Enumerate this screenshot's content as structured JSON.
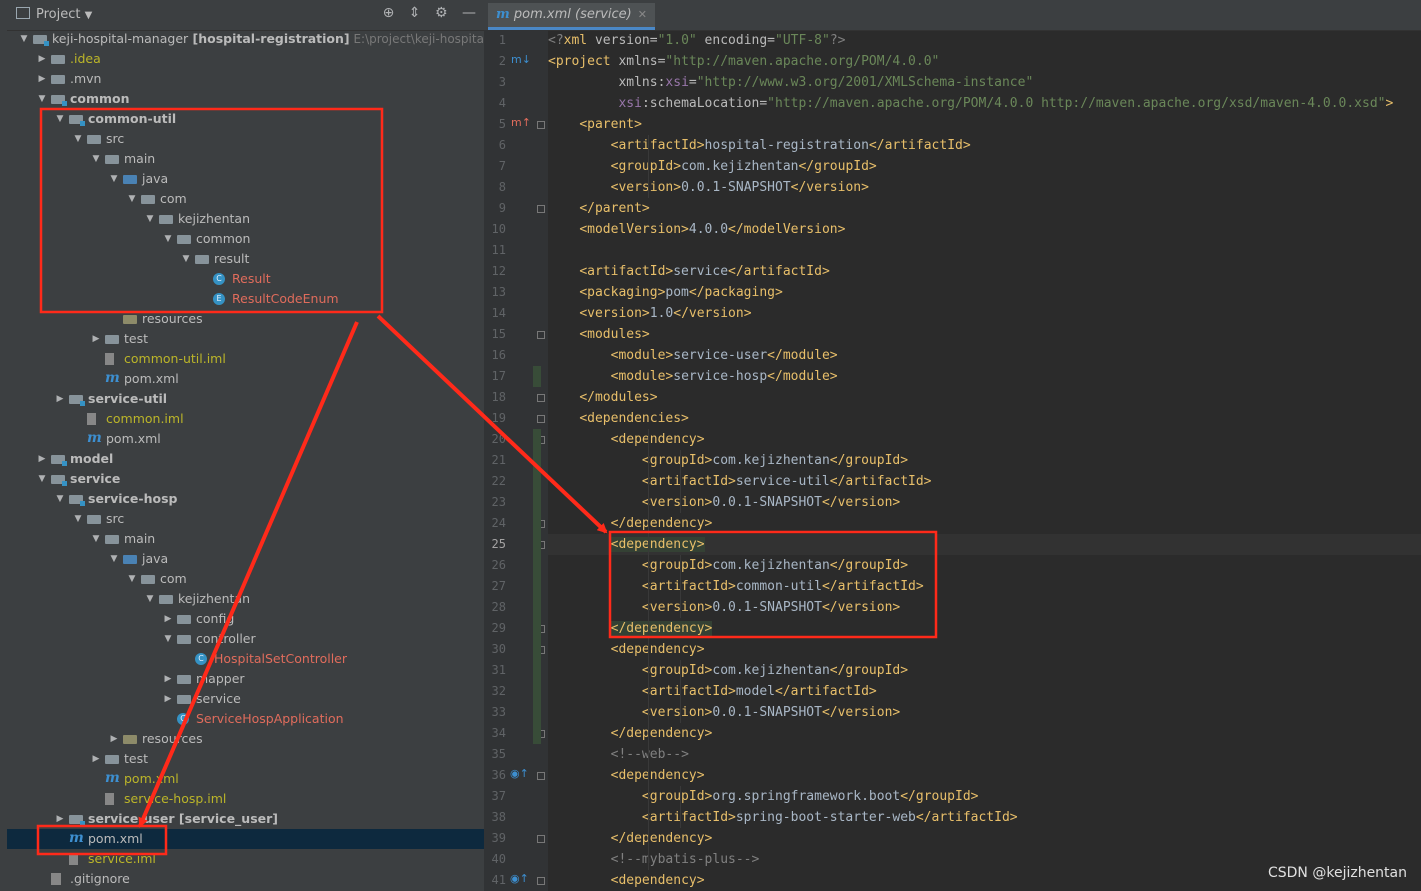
{
  "project_panel": {
    "title": "Project",
    "tree": [
      {
        "depth": 0,
        "arrow": "down",
        "icon": "folder-module",
        "name": "keji-hospital-manager",
        "extra": "[hospital-registration]",
        "path": "E:\\project\\keji-hospital-manager",
        "style": "root"
      },
      {
        "depth": 1,
        "arrow": "right",
        "icon": "folder",
        "name": ".idea",
        "style": "yellow"
      },
      {
        "depth": 1,
        "arrow": "right",
        "icon": "folder",
        "name": ".mvn",
        "style": "normal"
      },
      {
        "depth": 1,
        "arrow": "down",
        "icon": "folder-module",
        "name": "common",
        "style": "bold"
      },
      {
        "depth": 2,
        "arrow": "down",
        "icon": "folder-module",
        "name": "common-util",
        "style": "bold"
      },
      {
        "depth": 3,
        "arrow": "down",
        "icon": "folder",
        "name": "src",
        "style": "normal"
      },
      {
        "depth": 4,
        "arrow": "down",
        "icon": "folder",
        "name": "main",
        "style": "normal"
      },
      {
        "depth": 5,
        "arrow": "down",
        "icon": "folder-src",
        "name": "java",
        "style": "normal"
      },
      {
        "depth": 6,
        "arrow": "down",
        "icon": "folder",
        "name": "com",
        "style": "normal"
      },
      {
        "depth": 7,
        "arrow": "down",
        "icon": "folder",
        "name": "kejizhentan",
        "style": "normal"
      },
      {
        "depth": 8,
        "arrow": "down",
        "icon": "folder",
        "name": "common",
        "style": "normal"
      },
      {
        "depth": 9,
        "arrow": "down",
        "icon": "folder",
        "name": "result",
        "style": "normal"
      },
      {
        "depth": 10,
        "arrow": "none",
        "icon": "class",
        "name": "Result",
        "style": "red"
      },
      {
        "depth": 10,
        "arrow": "none",
        "icon": "enum",
        "name": "ResultCodeEnum",
        "style": "red"
      },
      {
        "depth": 5,
        "arrow": "none",
        "icon": "folder-res",
        "name": "resources",
        "style": "normal"
      },
      {
        "depth": 4,
        "arrow": "right",
        "icon": "folder",
        "name": "test",
        "style": "normal"
      },
      {
        "depth": 4,
        "arrow": "none",
        "icon": "iml",
        "name": "common-util.iml",
        "style": "yellow"
      },
      {
        "depth": 4,
        "arrow": "none",
        "icon": "maven",
        "name": "pom.xml",
        "style": "normal"
      },
      {
        "depth": 2,
        "arrow": "right",
        "icon": "folder-module",
        "name": "service-util",
        "style": "bold"
      },
      {
        "depth": 3,
        "arrow": "none",
        "icon": "iml",
        "name": "common.iml",
        "style": "yellow"
      },
      {
        "depth": 3,
        "arrow": "none",
        "icon": "maven",
        "name": "pom.xml",
        "style": "normal"
      },
      {
        "depth": 1,
        "arrow": "right",
        "icon": "folder-module",
        "name": "model",
        "style": "bold"
      },
      {
        "depth": 1,
        "arrow": "down",
        "icon": "folder-module",
        "name": "service",
        "style": "bold"
      },
      {
        "depth": 2,
        "arrow": "down",
        "icon": "folder-module",
        "name": "service-hosp",
        "style": "bold"
      },
      {
        "depth": 3,
        "arrow": "down",
        "icon": "folder",
        "name": "src",
        "style": "normal"
      },
      {
        "depth": 4,
        "arrow": "down",
        "icon": "folder",
        "name": "main",
        "style": "normal"
      },
      {
        "depth": 5,
        "arrow": "down",
        "icon": "folder-src",
        "name": "java",
        "style": "normal"
      },
      {
        "depth": 6,
        "arrow": "down",
        "icon": "folder",
        "name": "com",
        "style": "normal"
      },
      {
        "depth": 7,
        "arrow": "down",
        "icon": "folder",
        "name": "kejizhentan",
        "style": "normal"
      },
      {
        "depth": 8,
        "arrow": "right",
        "icon": "folder",
        "name": "config",
        "style": "normal"
      },
      {
        "depth": 8,
        "arrow": "down",
        "icon": "folder",
        "name": "controller",
        "style": "normal"
      },
      {
        "depth": 9,
        "arrow": "none",
        "icon": "class",
        "name": "HospitalSetController",
        "style": "red"
      },
      {
        "depth": 8,
        "arrow": "right",
        "icon": "folder",
        "name": "mapper",
        "style": "normal"
      },
      {
        "depth": 8,
        "arrow": "right",
        "icon": "folder",
        "name": "service",
        "style": "normal"
      },
      {
        "depth": 8,
        "arrow": "none",
        "icon": "class",
        "name": "ServiceHospApplication",
        "style": "red"
      },
      {
        "depth": 5,
        "arrow": "right",
        "icon": "folder-res",
        "name": "resources",
        "style": "normal"
      },
      {
        "depth": 4,
        "arrow": "right",
        "icon": "folder",
        "name": "test",
        "style": "normal"
      },
      {
        "depth": 4,
        "arrow": "none",
        "icon": "maven",
        "name": "pom.xml",
        "style": "yellow"
      },
      {
        "depth": 4,
        "arrow": "none",
        "icon": "iml",
        "name": "service-hosp.iml",
        "style": "yellow"
      },
      {
        "depth": 2,
        "arrow": "right",
        "icon": "folder-module",
        "name": "service-user",
        "extra": "[service_user]",
        "style": "bold-extra"
      },
      {
        "depth": 2,
        "arrow": "none",
        "icon": "maven",
        "name": "pom.xml",
        "style": "normal",
        "selected": true
      },
      {
        "depth": 2,
        "arrow": "none",
        "icon": "iml",
        "name": "service.iml",
        "style": "yellow"
      },
      {
        "depth": 1,
        "arrow": "none",
        "icon": "git",
        "name": ".gitignore",
        "style": "normal"
      }
    ]
  },
  "editor": {
    "tab_label": "pom.xml (service)",
    "current_line": 25,
    "lines": [
      {
        "n": 1,
        "html": "<span class=\"cm\">&lt;?</span><span class=\"tg\">xml </span><span class=\"at\">version=</span><span class=\"av\">\"1.0\"</span><span class=\"at\"> encoding=</span><span class=\"av\">\"UTF-8\"</span><span class=\"cm\">?&gt;</span>"
      },
      {
        "n": 2,
        "html": "<span class=\"tg\">&lt;project </span><span class=\"at\">xmlns=</span><span class=\"av\">\"http://maven.apache.org/POM/4.0.0\"</span>"
      },
      {
        "n": 3,
        "html": "         <span class=\"at\">xmlns:</span><span class=\"ns\">xsi</span><span class=\"at\">=</span><span class=\"av\">\"http://www.w3.org/2001/XMLSchema-instance\"</span>"
      },
      {
        "n": 4,
        "html": "         <span class=\"ns\">xsi</span><span class=\"at\">:schemaLocation=</span><span class=\"av\">\"http://maven.apache.org/POM/4.0.0 http://maven.apache.org/xsd/maven-4.0.0.xsd\"</span><span class=\"tg\">&gt;</span>"
      },
      {
        "n": 5,
        "html": "    <span class=\"tg\">&lt;parent&gt;</span>"
      },
      {
        "n": 6,
        "html": "        <span class=\"tg\">&lt;artifactId&gt;</span>hospital-registration<span class=\"tg\">&lt;/artifactId&gt;</span>"
      },
      {
        "n": 7,
        "html": "        <span class=\"tg\">&lt;groupId&gt;</span>com.kejizhentan<span class=\"tg\">&lt;/groupId&gt;</span>"
      },
      {
        "n": 8,
        "html": "        <span class=\"tg\">&lt;version&gt;</span>0.0.1-SNAPSHOT<span class=\"tg\">&lt;/version&gt;</span>"
      },
      {
        "n": 9,
        "html": "    <span class=\"tg\">&lt;/parent&gt;</span>"
      },
      {
        "n": 10,
        "html": "    <span class=\"tg\">&lt;modelVersion&gt;</span>4.0.0<span class=\"tg\">&lt;/modelVersion&gt;</span>"
      },
      {
        "n": 11,
        "html": ""
      },
      {
        "n": 12,
        "html": "    <span class=\"tg\">&lt;artifactId&gt;</span>service<span class=\"tg\">&lt;/artifactId&gt;</span>"
      },
      {
        "n": 13,
        "html": "    <span class=\"tg\">&lt;packaging&gt;</span>pom<span class=\"tg\">&lt;/packaging&gt;</span>"
      },
      {
        "n": 14,
        "html": "    <span class=\"tg\">&lt;version&gt;</span>1.0<span class=\"tg\">&lt;/version&gt;</span>"
      },
      {
        "n": 15,
        "html": "    <span class=\"tg\">&lt;modules&gt;</span>"
      },
      {
        "n": 16,
        "html": "        <span class=\"tg\">&lt;module&gt;</span>service-user<span class=\"tg\">&lt;/module&gt;</span>"
      },
      {
        "n": 17,
        "html": "        <span class=\"tg\">&lt;module&gt;</span>service-hosp<span class=\"tg\">&lt;/module&gt;</span>"
      },
      {
        "n": 18,
        "html": "    <span class=\"tg\">&lt;/modules&gt;</span>"
      },
      {
        "n": 19,
        "html": "    <span class=\"tg\">&lt;dependencies&gt;</span>"
      },
      {
        "n": 20,
        "html": "        <span class=\"tg\">&lt;dependency&gt;</span>"
      },
      {
        "n": 21,
        "html": "            <span class=\"tg\">&lt;groupId&gt;</span>com.kejizhentan<span class=\"tg\">&lt;/groupId&gt;</span>"
      },
      {
        "n": 22,
        "html": "            <span class=\"tg\">&lt;artifactId&gt;</span>service-util<span class=\"tg\">&lt;/artifactId&gt;</span>"
      },
      {
        "n": 23,
        "html": "            <span class=\"tg\">&lt;version&gt;</span>0.0.1-SNAPSHOT<span class=\"tg\">&lt;/version&gt;</span>"
      },
      {
        "n": 24,
        "html": "        <span class=\"tg\">&lt;/dependency&gt;</span>"
      },
      {
        "n": 25,
        "html": "        <span class=\"tg hlt\">&lt;dependency&gt;</span>"
      },
      {
        "n": 26,
        "html": "            <span class=\"tg\">&lt;groupId&gt;</span>com.kejizhentan<span class=\"tg\">&lt;/groupId&gt;</span>"
      },
      {
        "n": 27,
        "html": "            <span class=\"tg\">&lt;artifactId&gt;</span>common-util<span class=\"tg\">&lt;/artifactId&gt;</span>"
      },
      {
        "n": 28,
        "html": "            <span class=\"tg\">&lt;version&gt;</span>0.0.1-SNAPSHOT<span class=\"tg\">&lt;/version&gt;</span>"
      },
      {
        "n": 29,
        "html": "        <span class=\"tg hlt\">&lt;/dependency&gt;</span>"
      },
      {
        "n": 30,
        "html": "        <span class=\"tg\">&lt;dependency&gt;</span>"
      },
      {
        "n": 31,
        "html": "            <span class=\"tg\">&lt;groupId&gt;</span>com.kejizhentan<span class=\"tg\">&lt;/groupId&gt;</span>"
      },
      {
        "n": 32,
        "html": "            <span class=\"tg\">&lt;artifactId&gt;</span>model<span class=\"tg\">&lt;/artifactId&gt;</span>"
      },
      {
        "n": 33,
        "html": "            <span class=\"tg\">&lt;version&gt;</span>0.0.1-SNAPSHOT<span class=\"tg\">&lt;/version&gt;</span>"
      },
      {
        "n": 34,
        "html": "        <span class=\"tg\">&lt;/dependency&gt;</span>"
      },
      {
        "n": 35,
        "html": "        <span class=\"cm\">&lt;!--web--&gt;</span>"
      },
      {
        "n": 36,
        "html": "        <span class=\"tg\">&lt;dependency&gt;</span>"
      },
      {
        "n": 37,
        "html": "            <span class=\"tg\">&lt;groupId&gt;</span>org.springframework.boot<span class=\"tg\">&lt;/groupId&gt;</span>"
      },
      {
        "n": 38,
        "html": "            <span class=\"tg\">&lt;artifactId&gt;</span>spring-boot-starter-web<span class=\"tg\">&lt;/artifactId&gt;</span>"
      },
      {
        "n": 39,
        "html": "        <span class=\"tg\">&lt;/dependency&gt;</span>"
      },
      {
        "n": 40,
        "html": "        <span class=\"cm\">&lt;!--mybatis-plus--&gt;</span>"
      },
      {
        "n": 41,
        "html": "        <span class=\"tg\">&lt;dependency&gt;</span>"
      }
    ]
  },
  "watermark": "CSDN @kejizhentan",
  "colors": {
    "annotation": "#ff2a1a",
    "selection": "#0d293e",
    "tag": "#e8bf6a",
    "string": "#6a8759"
  }
}
